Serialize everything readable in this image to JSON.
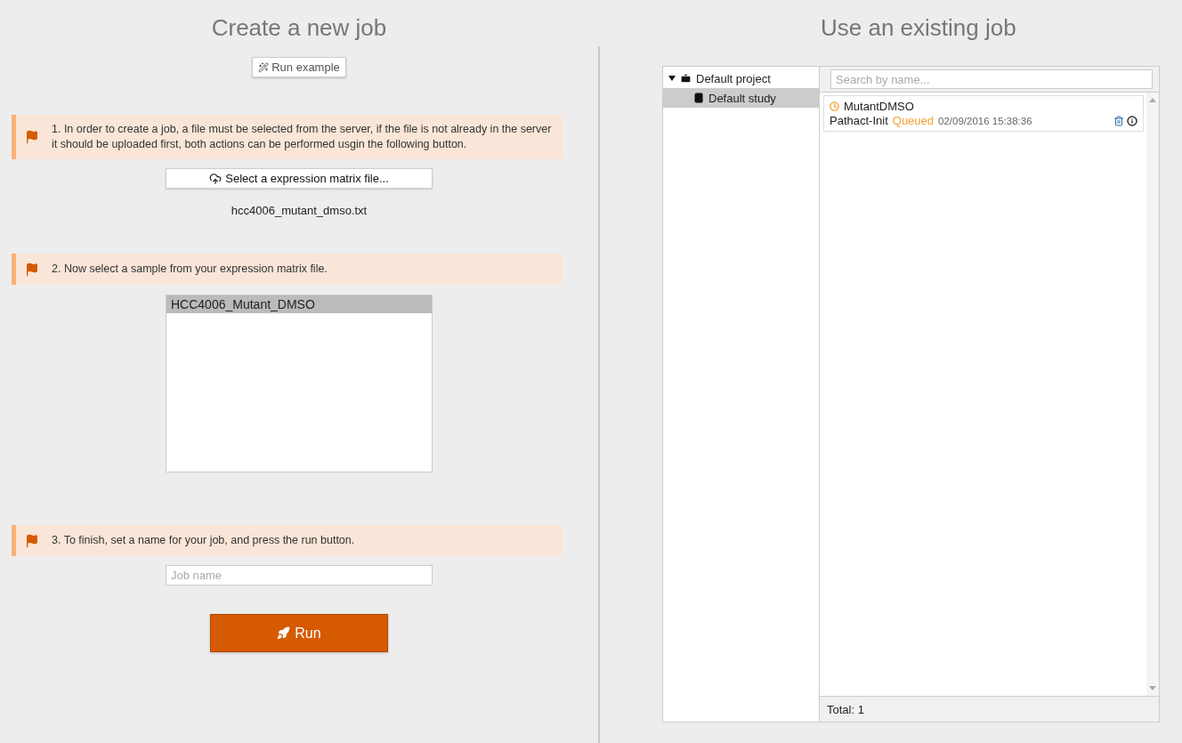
{
  "new_job": {
    "title": "Create a new job",
    "example_button": "Run example",
    "step_1": {
      "text": "1. In order to create a job, a file must be selected from the server, if the file is not already in the server it should be uploaded first, both actions can be performed usgin the following button.",
      "button": "Select a expression matrix file...",
      "file_name": "hcc4006_mutant_dmso.txt"
    },
    "step_2": {
      "text": "2. Now select a sample from your expression matrix file.",
      "samples": [
        {
          "label": "HCC4006_Mutant_DMSO",
          "selected": true
        }
      ]
    },
    "step_3": {
      "text": "3. To finish, set a name for your job, and press the run button.",
      "name_field": {
        "placeholder": "Job name"
      },
      "run_button": "Run"
    }
  },
  "existing_job": {
    "title": "Use an existing job",
    "tree": [
      {
        "label": "Default project",
        "expanded": true,
        "selected": false,
        "children": [
          {
            "label": "Default study",
            "selected": true
          }
        ]
      }
    ],
    "search": {
      "placeholder": "Search by name..."
    },
    "jobs": [
      {
        "name": "MutantDMSO",
        "tool": "Pathact-Init",
        "status": "Queued",
        "date": "02/09/2016 15:38:36"
      }
    ],
    "total": "Total: 1"
  }
}
